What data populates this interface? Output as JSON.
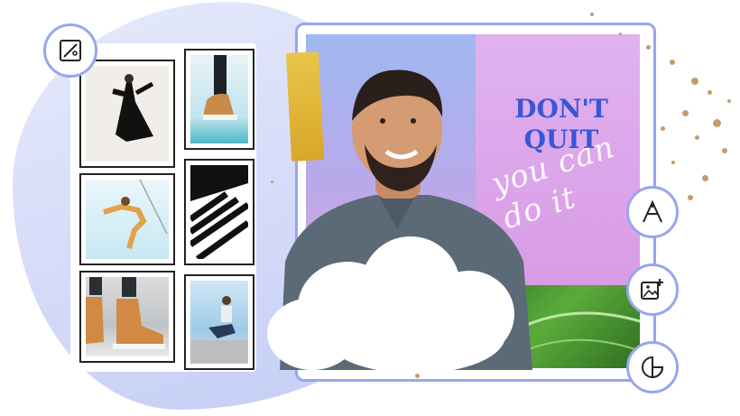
{
  "canvas": {
    "headline_line1": "DON'T",
    "headline_line2": "QUIT",
    "script_text": "you can do it"
  },
  "tools": [
    {
      "name": "text",
      "icon": "text-tool-icon"
    },
    {
      "name": "add-image",
      "icon": "add-image-icon"
    },
    {
      "name": "sticker",
      "icon": "sticker-icon"
    }
  ],
  "photo_tool": {
    "icon": "image-edit-icon"
  },
  "colors": {
    "accent": "#97a6ef",
    "headline": "#3956d6",
    "pink_panel": "#d99be6",
    "sky": "#9fb8f0",
    "tape": "#e0b43a"
  }
}
